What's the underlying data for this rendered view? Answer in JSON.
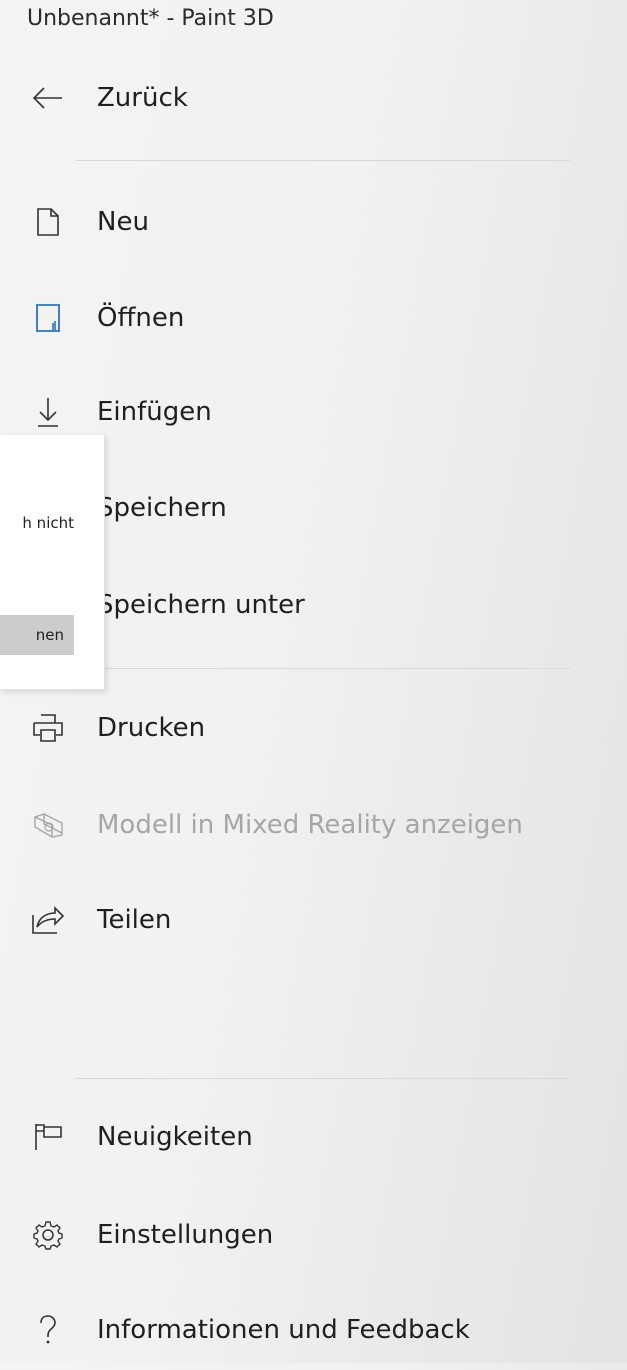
{
  "window": {
    "title": "Unbenannt* - Paint 3D"
  },
  "menu": {
    "back": {
      "label": "Zurück",
      "icon": "arrow-left-icon"
    },
    "items": [
      {
        "id": "neu",
        "label": "Neu",
        "icon": "new-file-icon"
      },
      {
        "id": "oeffnen",
        "label": "Öffnen",
        "icon": "open-folder-icon"
      },
      {
        "id": "einfuegen",
        "label": "Einfügen",
        "icon": "download-arrow-icon"
      },
      {
        "id": "speichern",
        "label": "Speichern",
        "icon": "save-icon"
      },
      {
        "id": "speichern-unter",
        "label": "Speichern unter",
        "icon": "save-as-icon"
      },
      {
        "id": "drucken",
        "label": "Drucken",
        "icon": "printer-icon"
      },
      {
        "id": "mixed-reality",
        "label": "Modell in Mixed Reality anzeigen",
        "icon": "mixed-reality-icon",
        "disabled": true
      },
      {
        "id": "teilen",
        "label": "Teilen",
        "icon": "share-icon"
      },
      {
        "id": "neuigkeiten",
        "label": "Neuigkeiten",
        "icon": "flag-icon"
      },
      {
        "id": "einstellungen",
        "label": "Einstellungen",
        "icon": "gear-icon"
      },
      {
        "id": "info",
        "label": "Informationen und Feedback",
        "icon": "question-icon"
      }
    ]
  },
  "popup": {
    "text_fragment": "h nicht",
    "button_fragment": "nen"
  },
  "colors": {
    "accent": "#2a73c4",
    "disabled_text": "#a6a6a6",
    "popup_button": "#cccccc"
  }
}
